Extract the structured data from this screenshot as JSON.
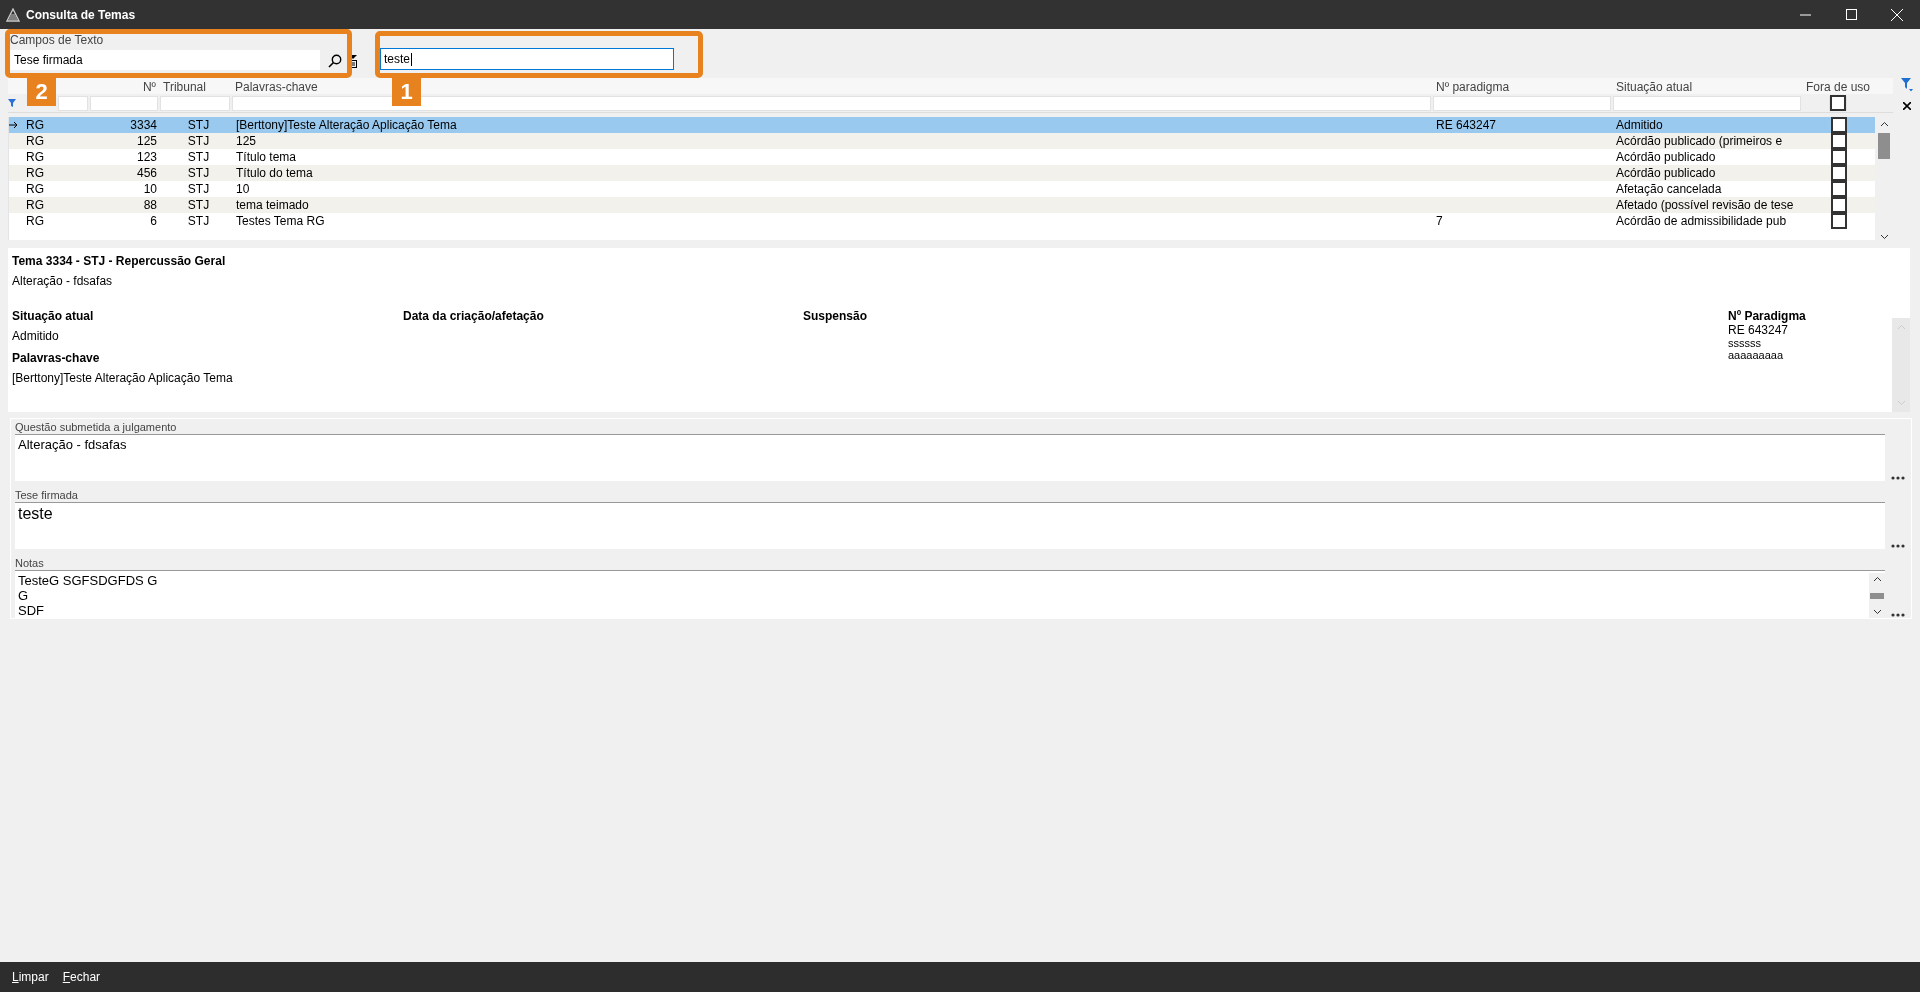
{
  "window": {
    "title": "Consulta de Temas"
  },
  "text_field_selector": {
    "label": "Campos de Texto",
    "value": "Tese firmada"
  },
  "search": {
    "value": "teste",
    "focused": true
  },
  "annotations": [
    {
      "label": "2",
      "kind": "selector"
    },
    {
      "label": "1",
      "kind": "search"
    }
  ],
  "table": {
    "columns": [
      "Nº",
      "Tribunal",
      "Palavras-chave",
      "Nº paradigma",
      "Situação atual",
      "Fora de uso"
    ],
    "filter_out_of_use": false,
    "rows": [
      {
        "origin": "RG",
        "number": "3334",
        "court": "STJ",
        "keywords": "[Berttony]Teste Alteração Aplicação Tema",
        "paradigm": "RE 643247",
        "status": "Admitido",
        "out_of_use": false,
        "selected": true
      },
      {
        "origin": "RG",
        "number": "125",
        "court": "STJ",
        "keywords": "125",
        "status": "Acórdão publicado (primeiros e",
        "out_of_use": false,
        "selected": false
      },
      {
        "origin": "RG",
        "number": "123",
        "court": "STJ",
        "keywords": "Título tema",
        "status": "Acórdão publicado",
        "out_of_use": false,
        "selected": false
      },
      {
        "origin": "RG",
        "number": "456",
        "court": "STJ",
        "keywords": "Título do tema",
        "status": "Acórdão publicado",
        "out_of_use": false,
        "selected": false
      },
      {
        "origin": "RG",
        "number": "10",
        "court": "STJ",
        "keywords": "10",
        "status": "Afetação cancelada",
        "out_of_use": false,
        "selected": false
      },
      {
        "origin": "RG",
        "number": "88",
        "court": "STJ",
        "keywords": "tema teimado",
        "status": "Afetado (possível revisão de tese",
        "out_of_use": false,
        "selected": false
      },
      {
        "origin": "RG",
        "number": "6",
        "court": "STJ",
        "keywords": "Testes Tema RG",
        "paradigm": "7",
        "status": "Acórdão de admissibilidade pub",
        "out_of_use": false,
        "selected": false
      }
    ]
  },
  "details": {
    "title": "Tema 3334 - STJ - Repercussão Geral",
    "subtitle": "Alteração - fdsafas",
    "status_label": "Situação atual",
    "status_value": "Admitido",
    "date_label": "Data da criação/afetação",
    "suspension_label": "Suspensão",
    "keywords_label": "Palavras-chave",
    "keywords_value": "[Berttony]Teste Alteração Aplicação Tema",
    "paradigm_label": "Nº Paradigma",
    "paradigm_values": [
      "RE 643247",
      "ssssss",
      "aaaaaaaaa"
    ]
  },
  "memos": [
    {
      "label": "Questão submetida a julgamento",
      "lines": [
        "Alteração - fdsafas"
      ],
      "kind": "plain"
    },
    {
      "label": "Tese firmada",
      "lines": [
        "teste"
      ],
      "kind": "large"
    },
    {
      "label": "Notas",
      "lines": [
        "TesteG SGFSDGFDS G",
        "G",
        "SDF"
      ],
      "kind": "scroll"
    }
  ],
  "footer": {
    "buttons": [
      "Limpar",
      "Fechar"
    ]
  }
}
